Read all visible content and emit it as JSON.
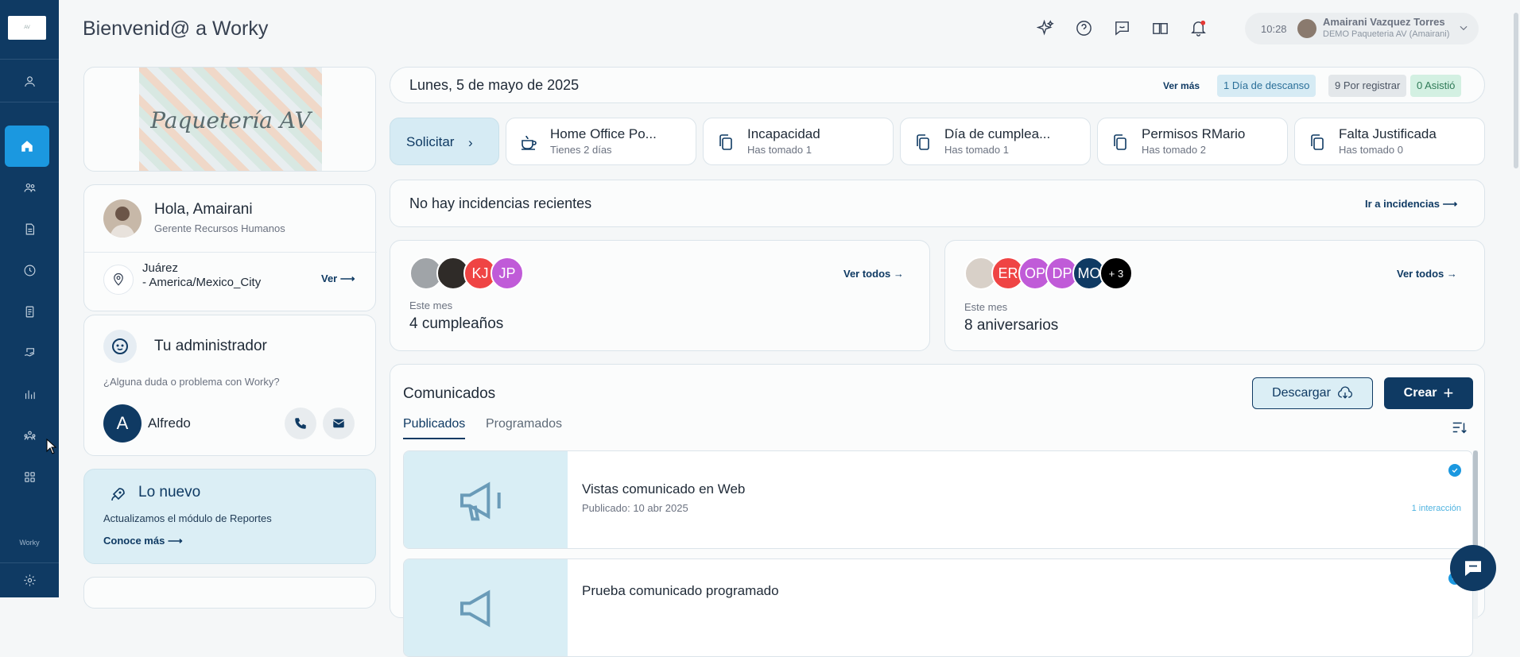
{
  "app": {
    "page_title": "Bienvenid@ a Worky",
    "footer_brand": "Worky"
  },
  "topbar": {
    "time": "10:28",
    "user_name": "Amairani Vazquez Torres",
    "user_company": "DEMO Paqueteria AV (Amairani)",
    "icons": [
      "sparkles-icon",
      "help-icon",
      "chat-icon",
      "book-icon",
      "notifications-icon"
    ]
  },
  "sidebar": {
    "items": [
      "user-icon",
      "home-icon",
      "team-icon",
      "document-icon",
      "clock-icon",
      "file-icon",
      "payroll-icon",
      "reports-icon",
      "organization-icon",
      "apps-icon",
      "settings-icon"
    ]
  },
  "company_logo_text": "Paquetería AV",
  "greeting": {
    "name": "Hola, Amairani",
    "role": "Gerente Recursos Humanos",
    "location_line1": "Juárez",
    "location_line2": "- America/Mexico_City",
    "link": "Ver"
  },
  "admin": {
    "title": "Tu administrador",
    "question": "¿Alguna duda o problema con Worky?",
    "initial": "A",
    "name": "Alfredo"
  },
  "whats_new": {
    "title": "Lo nuevo",
    "text": "Actualizamos el módulo de Reportes",
    "link": "Conoce más"
  },
  "date_bar": {
    "date": "Lunes, 5 de mayo de 2025",
    "more": "Ver más",
    "badges": [
      {
        "label": "1 Día de descanso",
        "bg": "#d6ebf4",
        "color": "#2a6f99"
      },
      {
        "label": "9 Por registrar",
        "bg": "#e3e7ea",
        "color": "#4b5563"
      },
      {
        "label": "0 Asistió",
        "bg": "#d3f0e2",
        "color": "#2f7a57"
      }
    ]
  },
  "requests": {
    "button": "Solicitar",
    "items": [
      {
        "title": "Home Office Po...",
        "sub": "Tienes 2 días"
      },
      {
        "title": "Incapacidad",
        "sub": "Has tomado 1"
      },
      {
        "title": "Día de cumplea...",
        "sub": "Has tomado 1"
      },
      {
        "title": "Permisos RMario",
        "sub": "Has tomado 2"
      },
      {
        "title": "Falta Justificada",
        "sub": "Has tomado 0"
      }
    ]
  },
  "incidents": {
    "text": "No hay incidencias recientes",
    "link": "Ir a incidencias"
  },
  "birthdays": {
    "avatars": [
      "",
      "",
      "KJ",
      "JP"
    ],
    "label": "Este mes",
    "count": "4 cumpleaños",
    "link": "Ver todos"
  },
  "anniversaries": {
    "avatars": [
      "",
      "ER",
      "OP",
      "DP",
      "MO",
      "+ 3"
    ],
    "label": "Este mes",
    "count": "8 aniversarios",
    "link": "Ver todos"
  },
  "announcements": {
    "title": "Comunicados",
    "download": "Descargar",
    "create": "Crear",
    "tabs": [
      "Publicados",
      "Programados"
    ],
    "items": [
      {
        "title": "Vistas comunicado en Web",
        "date": "Publicado: 10 abr 2025",
        "interactions": "1 interacción"
      },
      {
        "title": "Prueba comunicado programado",
        "date": "",
        "interactions": ""
      }
    ]
  },
  "colors": {
    "sidebar": "#0f3a63",
    "accent": "#1b98e0",
    "primary": "#0f3a63"
  }
}
